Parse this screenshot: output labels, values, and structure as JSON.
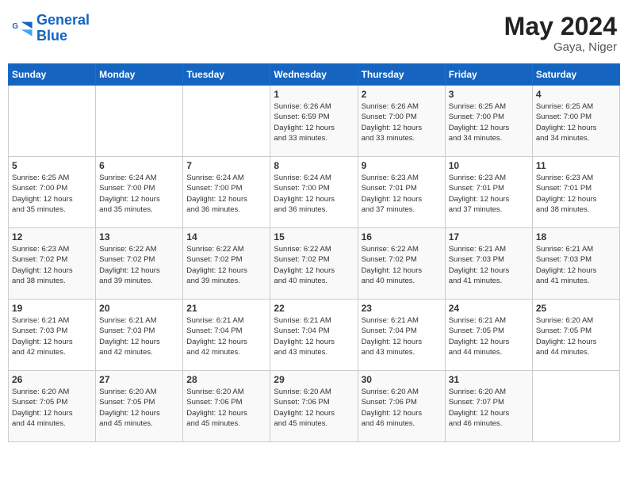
{
  "header": {
    "logo_line1": "General",
    "logo_line2": "Blue",
    "month_year": "May 2024",
    "location": "Gaya, Niger"
  },
  "days_of_week": [
    "Sunday",
    "Monday",
    "Tuesday",
    "Wednesday",
    "Thursday",
    "Friday",
    "Saturday"
  ],
  "weeks": [
    [
      {
        "day": "",
        "content": ""
      },
      {
        "day": "",
        "content": ""
      },
      {
        "day": "",
        "content": ""
      },
      {
        "day": "1",
        "content": "Sunrise: 6:26 AM\nSunset: 6:59 PM\nDaylight: 12 hours\nand 33 minutes."
      },
      {
        "day": "2",
        "content": "Sunrise: 6:26 AM\nSunset: 7:00 PM\nDaylight: 12 hours\nand 33 minutes."
      },
      {
        "day": "3",
        "content": "Sunrise: 6:25 AM\nSunset: 7:00 PM\nDaylight: 12 hours\nand 34 minutes."
      },
      {
        "day": "4",
        "content": "Sunrise: 6:25 AM\nSunset: 7:00 PM\nDaylight: 12 hours\nand 34 minutes."
      }
    ],
    [
      {
        "day": "5",
        "content": "Sunrise: 6:25 AM\nSunset: 7:00 PM\nDaylight: 12 hours\nand 35 minutes."
      },
      {
        "day": "6",
        "content": "Sunrise: 6:24 AM\nSunset: 7:00 PM\nDaylight: 12 hours\nand 35 minutes."
      },
      {
        "day": "7",
        "content": "Sunrise: 6:24 AM\nSunset: 7:00 PM\nDaylight: 12 hours\nand 36 minutes."
      },
      {
        "day": "8",
        "content": "Sunrise: 6:24 AM\nSunset: 7:00 PM\nDaylight: 12 hours\nand 36 minutes."
      },
      {
        "day": "9",
        "content": "Sunrise: 6:23 AM\nSunset: 7:01 PM\nDaylight: 12 hours\nand 37 minutes."
      },
      {
        "day": "10",
        "content": "Sunrise: 6:23 AM\nSunset: 7:01 PM\nDaylight: 12 hours\nand 37 minutes."
      },
      {
        "day": "11",
        "content": "Sunrise: 6:23 AM\nSunset: 7:01 PM\nDaylight: 12 hours\nand 38 minutes."
      }
    ],
    [
      {
        "day": "12",
        "content": "Sunrise: 6:23 AM\nSunset: 7:02 PM\nDaylight: 12 hours\nand 38 minutes."
      },
      {
        "day": "13",
        "content": "Sunrise: 6:22 AM\nSunset: 7:02 PM\nDaylight: 12 hours\nand 39 minutes."
      },
      {
        "day": "14",
        "content": "Sunrise: 6:22 AM\nSunset: 7:02 PM\nDaylight: 12 hours\nand 39 minutes."
      },
      {
        "day": "15",
        "content": "Sunrise: 6:22 AM\nSunset: 7:02 PM\nDaylight: 12 hours\nand 40 minutes."
      },
      {
        "day": "16",
        "content": "Sunrise: 6:22 AM\nSunset: 7:02 PM\nDaylight: 12 hours\nand 40 minutes."
      },
      {
        "day": "17",
        "content": "Sunrise: 6:21 AM\nSunset: 7:03 PM\nDaylight: 12 hours\nand 41 minutes."
      },
      {
        "day": "18",
        "content": "Sunrise: 6:21 AM\nSunset: 7:03 PM\nDaylight: 12 hours\nand 41 minutes."
      }
    ],
    [
      {
        "day": "19",
        "content": "Sunrise: 6:21 AM\nSunset: 7:03 PM\nDaylight: 12 hours\nand 42 minutes."
      },
      {
        "day": "20",
        "content": "Sunrise: 6:21 AM\nSunset: 7:03 PM\nDaylight: 12 hours\nand 42 minutes."
      },
      {
        "day": "21",
        "content": "Sunrise: 6:21 AM\nSunset: 7:04 PM\nDaylight: 12 hours\nand 42 minutes."
      },
      {
        "day": "22",
        "content": "Sunrise: 6:21 AM\nSunset: 7:04 PM\nDaylight: 12 hours\nand 43 minutes."
      },
      {
        "day": "23",
        "content": "Sunrise: 6:21 AM\nSunset: 7:04 PM\nDaylight: 12 hours\nand 43 minutes."
      },
      {
        "day": "24",
        "content": "Sunrise: 6:21 AM\nSunset: 7:05 PM\nDaylight: 12 hours\nand 44 minutes."
      },
      {
        "day": "25",
        "content": "Sunrise: 6:20 AM\nSunset: 7:05 PM\nDaylight: 12 hours\nand 44 minutes."
      }
    ],
    [
      {
        "day": "26",
        "content": "Sunrise: 6:20 AM\nSunset: 7:05 PM\nDaylight: 12 hours\nand 44 minutes."
      },
      {
        "day": "27",
        "content": "Sunrise: 6:20 AM\nSunset: 7:05 PM\nDaylight: 12 hours\nand 45 minutes."
      },
      {
        "day": "28",
        "content": "Sunrise: 6:20 AM\nSunset: 7:06 PM\nDaylight: 12 hours\nand 45 minutes."
      },
      {
        "day": "29",
        "content": "Sunrise: 6:20 AM\nSunset: 7:06 PM\nDaylight: 12 hours\nand 45 minutes."
      },
      {
        "day": "30",
        "content": "Sunrise: 6:20 AM\nSunset: 7:06 PM\nDaylight: 12 hours\nand 46 minutes."
      },
      {
        "day": "31",
        "content": "Sunrise: 6:20 AM\nSunset: 7:07 PM\nDaylight: 12 hours\nand 46 minutes."
      },
      {
        "day": "",
        "content": ""
      }
    ]
  ]
}
